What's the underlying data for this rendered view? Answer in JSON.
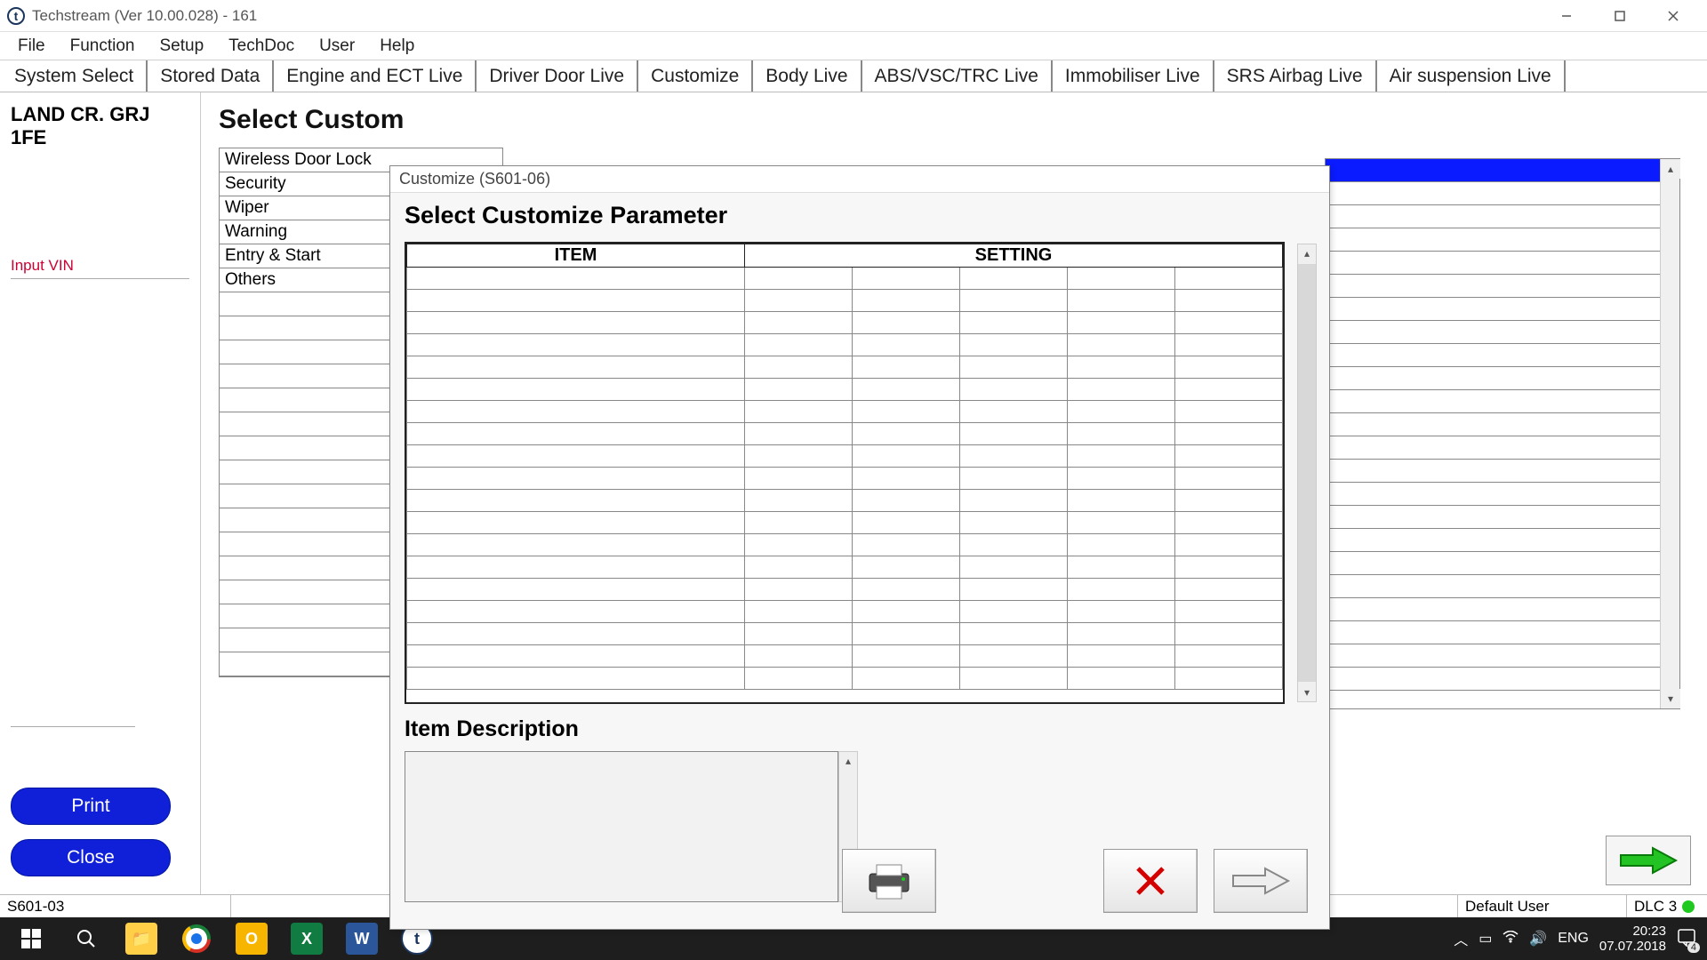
{
  "window": {
    "title": "Techstream (Ver 10.00.028) - 161",
    "icon_glyph": "t"
  },
  "menu": [
    "File",
    "Function",
    "Setup",
    "TechDoc",
    "User",
    "Help"
  ],
  "tabs": [
    "System Select",
    "Stored Data",
    "Engine and ECT Live",
    "Driver Door Live",
    "Customize",
    "Body Live",
    "ABS/VSC/TRC Live",
    "Immobiliser Live",
    "SRS Airbag Live",
    "Air suspension Live"
  ],
  "left_panel": {
    "vehicle": "LAND CR. GRJ\n1FE",
    "input_vin_label": "Input VIN",
    "print_label": "Print",
    "close_label": "Close"
  },
  "content": {
    "title_truncated": "Select Custom",
    "categories": [
      "Wireless Door Lock",
      "Security",
      "Wiper",
      "Warning",
      "Entry & Start",
      "Others"
    ],
    "category_blank_rows": 16
  },
  "modal": {
    "title": "Customize (S601-06)",
    "heading": "Select Customize Parameter",
    "headers": {
      "item": "ITEM",
      "setting": "SETTING"
    },
    "setting_subcols": 5,
    "blank_rows": 19,
    "desc_label": "Item Description"
  },
  "statusbar": {
    "code": "S601-03",
    "user": "Default User",
    "dlc": "DLC 3"
  },
  "taskbar": {
    "lang": "ENG",
    "time": "20:23",
    "date": "07.07.2018",
    "notif_badge": "4"
  }
}
